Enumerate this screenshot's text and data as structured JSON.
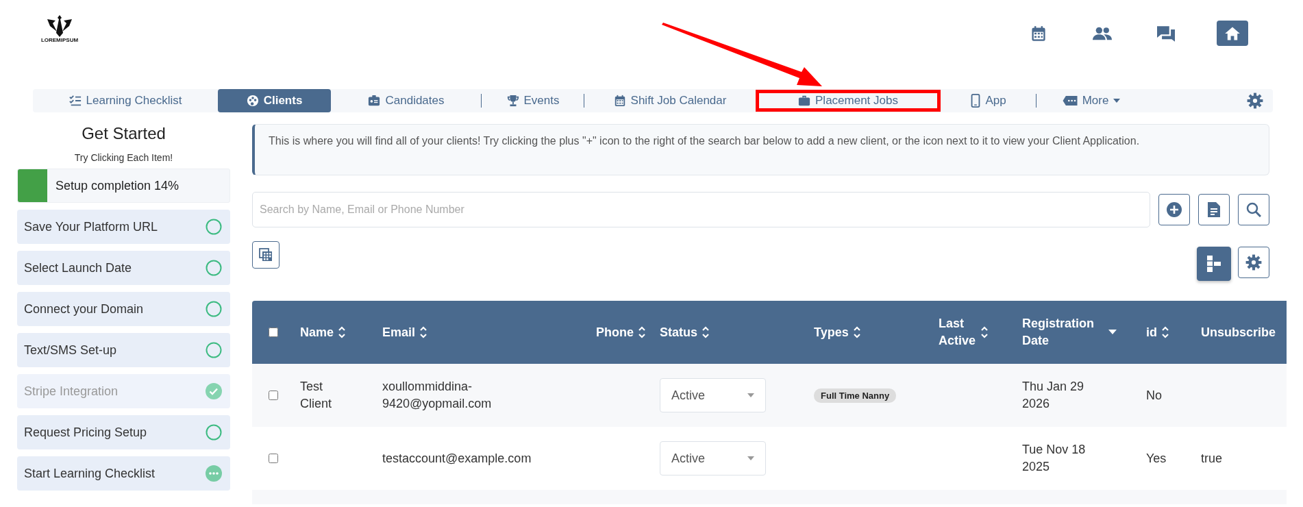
{
  "logo": {
    "text": "LOREMIPSUM"
  },
  "top_icons": [
    {
      "kind": "calendar",
      "selected": false
    },
    {
      "kind": "people",
      "selected": false
    },
    {
      "kind": "chat",
      "selected": false
    },
    {
      "kind": "home",
      "selected": true
    }
  ],
  "nav": {
    "tabs": [
      {
        "label": "Learning Checklist",
        "kind": "checklist",
        "selected": false,
        "highlighted": false,
        "separator_after": false,
        "dropdown": false
      },
      {
        "label": "Clients",
        "kind": "clients",
        "selected": true,
        "highlighted": false,
        "separator_after": false,
        "dropdown": false
      },
      {
        "label": "Candidates",
        "kind": "badge",
        "selected": false,
        "highlighted": false,
        "separator_after": true,
        "dropdown": false
      },
      {
        "label": "Events",
        "kind": "trophy",
        "selected": false,
        "highlighted": false,
        "separator_after": true,
        "dropdown": false
      },
      {
        "label": "Shift Job Calendar",
        "kind": "calendar",
        "selected": false,
        "highlighted": false,
        "separator_after": false,
        "dropdown": false
      },
      {
        "label": "Placement Jobs",
        "kind": "briefcase",
        "selected": false,
        "highlighted": true,
        "separator_after": false,
        "dropdown": false
      },
      {
        "label": "App",
        "kind": "phone",
        "selected": false,
        "highlighted": false,
        "separator_after": true,
        "dropdown": false
      },
      {
        "label": "More",
        "kind": "tag",
        "selected": false,
        "highlighted": false,
        "separator_after": false,
        "dropdown": true
      }
    ]
  },
  "sidebar": {
    "title": "Get Started",
    "subtitle": "Try Clicking Each Item!",
    "progress": {
      "label": "Setup completion 14%",
      "level": 0.14
    },
    "items": [
      {
        "label": "Save Your Platform URL",
        "kind": "todo"
      },
      {
        "label": "Select Launch Date",
        "kind": "todo"
      },
      {
        "label": "Connect your Domain",
        "kind": "todo"
      },
      {
        "label": "Text/SMS Set-up",
        "kind": "todo"
      },
      {
        "label": "Stripe Integration",
        "kind": "done"
      },
      {
        "label": "Request Pricing Setup",
        "kind": "todo"
      },
      {
        "label": "Start Learning Checklist",
        "kind": "pending"
      }
    ]
  },
  "info": "This is where you will find all of your clients! Try clicking the plus \"+\" icon to the right of the search bar below to add a new client, or the icon next to it to view your Client Application.",
  "search": {
    "placeholder": "Search by Name, Email or Phone Number"
  },
  "table": {
    "header_checked": false,
    "columns": [
      {
        "label": "Name",
        "kind": "sortable"
      },
      {
        "label": "Email",
        "kind": "sortable"
      },
      {
        "label": "Phone",
        "kind": "sortable"
      },
      {
        "label": "Status",
        "kind": "sortable"
      },
      {
        "label": "Types",
        "kind": "sortable"
      },
      {
        "label": "Last Active",
        "kind": "sortable"
      },
      {
        "label": "Registration Date",
        "kind": "sorted"
      },
      {
        "label": "id",
        "kind": "sortable"
      },
      {
        "label": "Unsubscribe",
        "kind": "plain"
      }
    ],
    "rows": [
      {
        "checked": false,
        "name": "Test Client",
        "email": "xoullommiddina-9420@yopmail.com",
        "status": "Active",
        "types": [
          "Full Time Nanny"
        ],
        "registration_date": "Thu Jan 29 2026",
        "id": "No"
      },
      {
        "checked": false,
        "email": "testaccount@example.com",
        "status": "Active",
        "types": [],
        "registration_date": "Tue Nov 18 2025",
        "id": "Yes",
        "unsubscribed": "true"
      }
    ]
  },
  "annotation": {
    "arrow": true
  }
}
